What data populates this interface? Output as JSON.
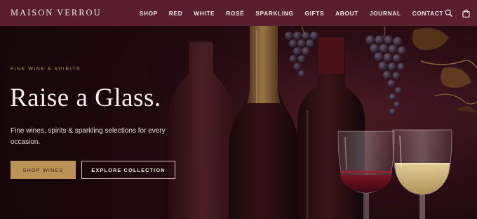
{
  "brand": {
    "name": "MAISON VERROU"
  },
  "nav": {
    "items": [
      {
        "label": "SHOP"
      },
      {
        "label": "RED"
      },
      {
        "label": "WHITE"
      },
      {
        "label": "ROSÉ"
      },
      {
        "label": "SPARKLING"
      },
      {
        "label": "GIFTS"
      },
      {
        "label": "ABOUT"
      },
      {
        "label": "JOURNAL"
      },
      {
        "label": "CONTACT"
      }
    ]
  },
  "header_icons": [
    "search-icon",
    "shopping-bag-icon"
  ],
  "hero": {
    "eyebrow": "FINE WINE & SPIRITS",
    "headline": "Raise a Glass.",
    "subcopy": "Fine wines, spirits & sparkling selections for every occasion.",
    "primary_cta": "SHOP WINES",
    "secondary_cta": "EXPLORE COLLECTION"
  },
  "colors": {
    "header_bg": "#5a1f2e",
    "accent_gold": "#bb9356",
    "hero_dark": "#1c0a10",
    "text_light": "#f5ede8"
  }
}
